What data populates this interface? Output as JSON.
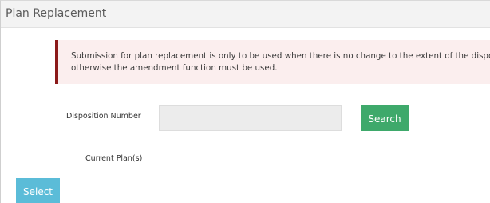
{
  "panel": {
    "title": "Plan Replacement"
  },
  "alert": {
    "line1": "Submission for plan replacement is only to be used when there is no change to the extent of the disposition;",
    "line2": "otherwise the amendment function must be used.",
    "border_color": "#8b1a1a",
    "background_color": "#fbeeee"
  },
  "form": {
    "disposition_label": "Disposition Number",
    "disposition_value": "",
    "search_label": "Search",
    "current_plans_label": "Current Plan(s)",
    "select_label": "Select"
  },
  "colors": {
    "search_button": "#3ea96b",
    "select_button": "#5bbcd8"
  }
}
